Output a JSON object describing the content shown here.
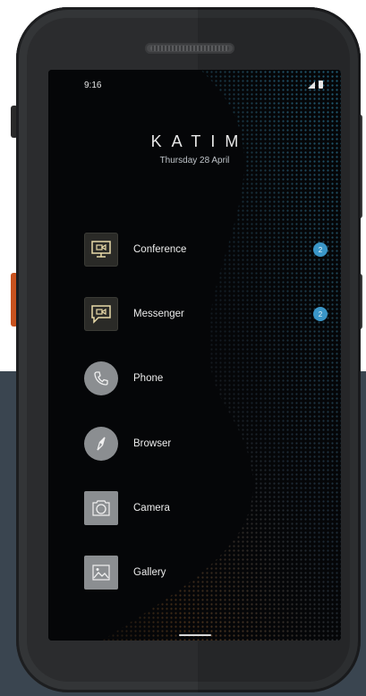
{
  "status_bar": {
    "time": "9:16"
  },
  "home": {
    "brand": "KATIM",
    "date": "Thursday 28 April"
  },
  "apps": [
    {
      "label": "Conference",
      "icon": "video-screen-icon",
      "badge": "2"
    },
    {
      "label": "Messenger",
      "icon": "chat-video-icon",
      "badge": "2"
    },
    {
      "label": "Phone",
      "icon": "phone-handset-icon"
    },
    {
      "label": "Browser",
      "icon": "compass-icon"
    },
    {
      "label": "Camera",
      "icon": "camera-icon"
    },
    {
      "label": "Gallery",
      "icon": "image-mountain-icon"
    }
  ],
  "colors": {
    "badge": "#3a96c8",
    "screen_bg": "#050608",
    "device_body": "#2b2c2e",
    "accent_button": "#c8521e"
  }
}
